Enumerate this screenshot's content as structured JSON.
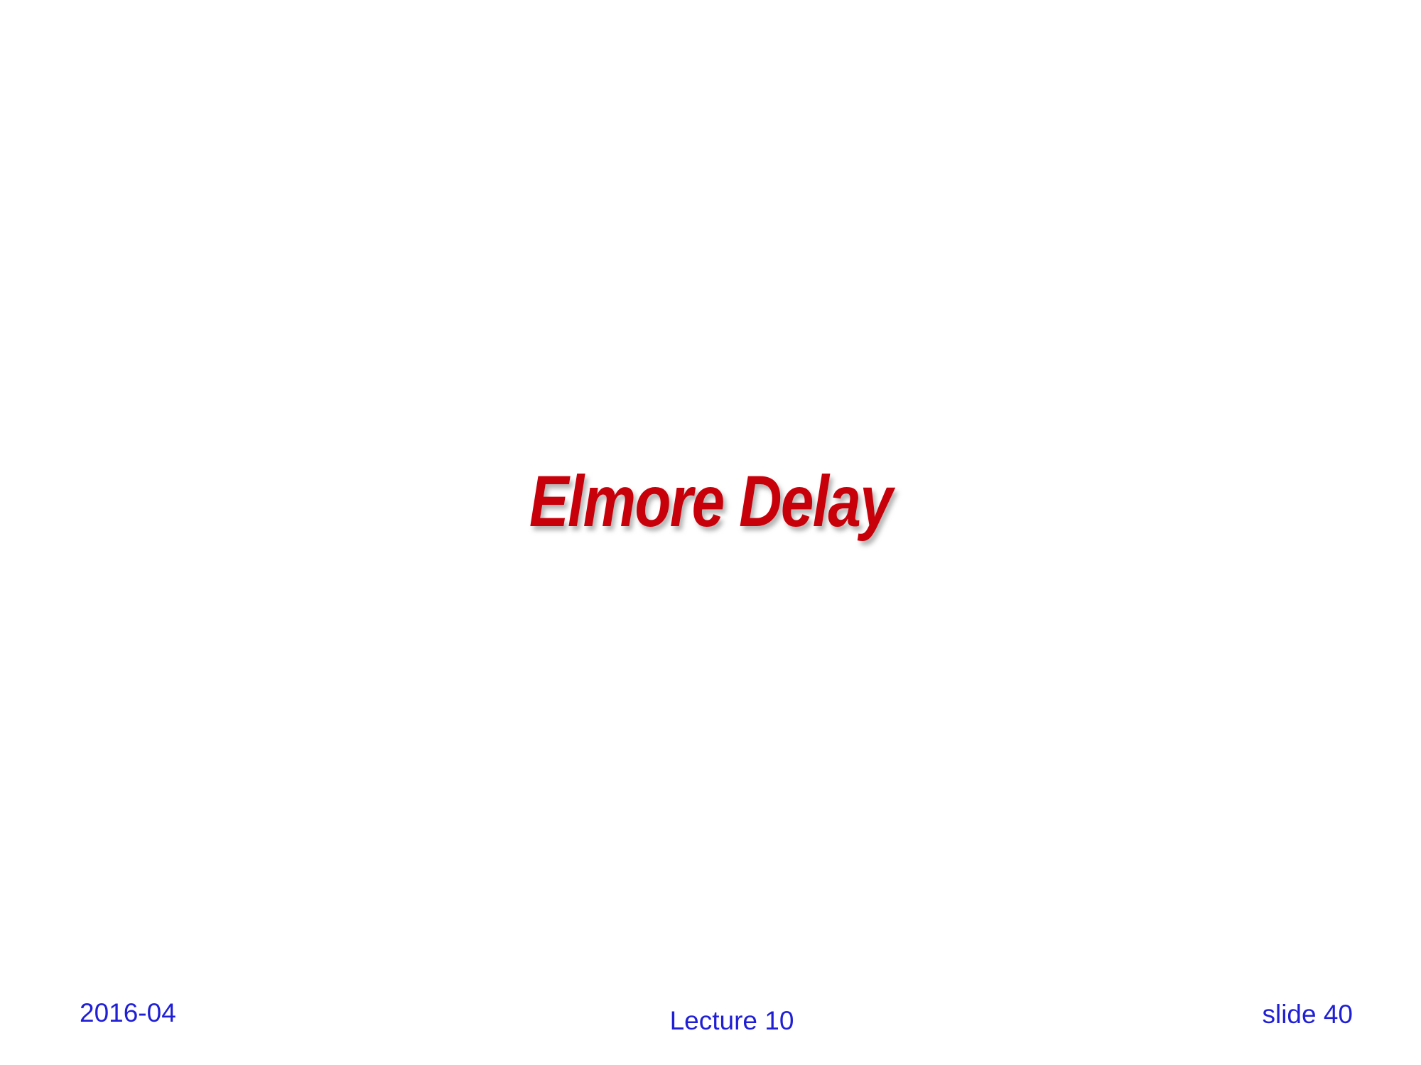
{
  "slide": {
    "title": "Elmore Delay",
    "footer": {
      "date": "2016-04",
      "lecture": "Lecture 10",
      "slide_number": "slide 40"
    }
  },
  "colors": {
    "title": "#c8000a",
    "footer_text": "#1f1fd6",
    "background": "#ffffff"
  }
}
